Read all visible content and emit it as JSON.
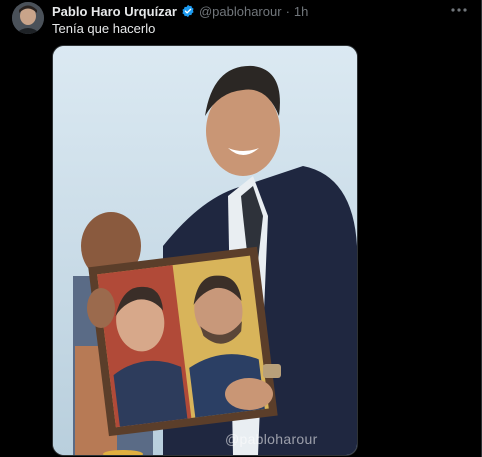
{
  "tweet": {
    "author_name": "Pablo Haro Urquízar",
    "handle": "@pabloharour",
    "separator": "·",
    "time": "1h",
    "text": "Tenía que hacerlo",
    "verified": true
  },
  "media": {
    "watermark": "@pabloharour"
  },
  "icons": {
    "verified": "verified-badge-icon",
    "more": "more-icon"
  },
  "colors": {
    "background": "#000000",
    "text": "#e7e9ea",
    "muted": "#71767b",
    "verified": "#1d9bf0"
  }
}
